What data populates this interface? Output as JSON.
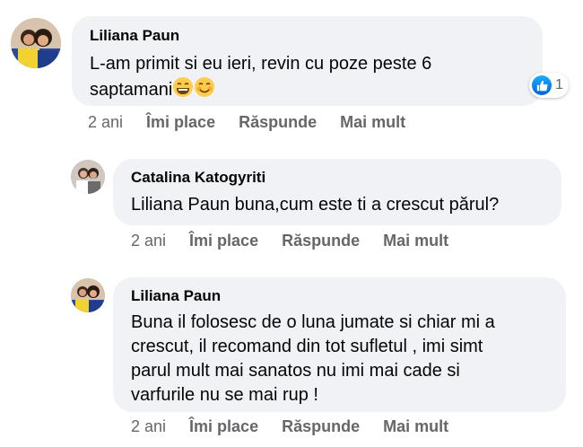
{
  "comments": [
    {
      "author": "Liliana Paun",
      "text_line1": "L-am primit si eu ieri, revin cu poze peste 6",
      "text_line2": "saptamani",
      "reaction_count": "1",
      "time": "2 ani",
      "like_label": "Îmi place",
      "reply_label": "Răspunde",
      "more_label": "Mai mult"
    },
    {
      "author": "Catalina Katogyriti",
      "text_line1": "Liliana Paun buna,cum este ti a crescut părul?",
      "time": "2 ani",
      "like_label": "Îmi place",
      "reply_label": "Răspunde",
      "more_label": "Mai mult"
    },
    {
      "author": "Liliana Paun",
      "text_line1": "Buna il folosesc de o luna jumate si chiar mi a",
      "text_line2": "crescut, il recomand din tot sufletul , imi simt",
      "text_line3": "parul mult mai sanatos nu imi mai cade si",
      "text_line4": "varfurile nu se mai rup !",
      "time": "2 ani",
      "like_label": "Îmi place",
      "reply_label": "Răspunde",
      "more_label": "Mai mult"
    }
  ],
  "colors": {
    "bubble": "#f0f2f5",
    "meta_text": "#65676b",
    "like_blue": "#0866ff",
    "emoji_yellow": "#ffcc4d"
  }
}
